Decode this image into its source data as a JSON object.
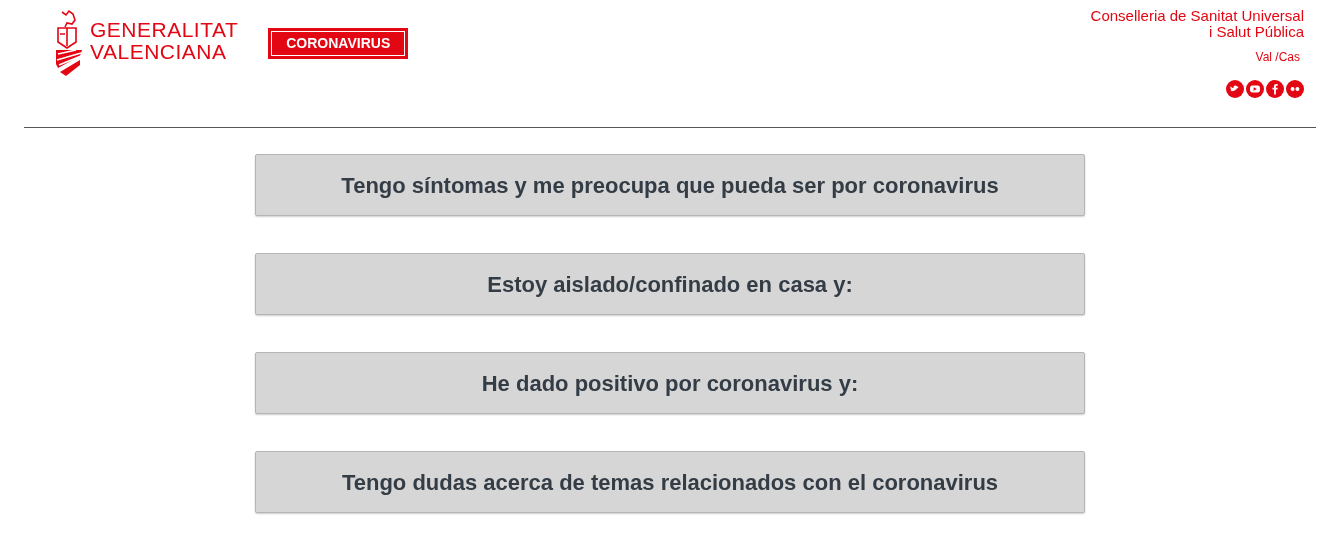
{
  "header": {
    "logo": {
      "line1": "GENERALITAT",
      "line2": "VALENCIANA"
    },
    "badge": "CORONAVIRUS",
    "department": [
      "Conselleria de Sanitat Universal",
      "i Salut Pública"
    ],
    "language": "Val /Cas",
    "social": [
      {
        "kind": "twitter"
      },
      {
        "kind": "youtube"
      },
      {
        "kind": "facebook"
      },
      {
        "kind": "flickr"
      }
    ]
  },
  "options": [
    {
      "label": "Tengo síntomas y me preocupa que pueda ser por coronavirus"
    },
    {
      "label": "Estoy aislado/confinado en casa y:"
    },
    {
      "label": "He dado positivo por coronavirus y:"
    },
    {
      "label": "Tengo dudas acerca de temas relacionados con el coronavirus"
    }
  ]
}
